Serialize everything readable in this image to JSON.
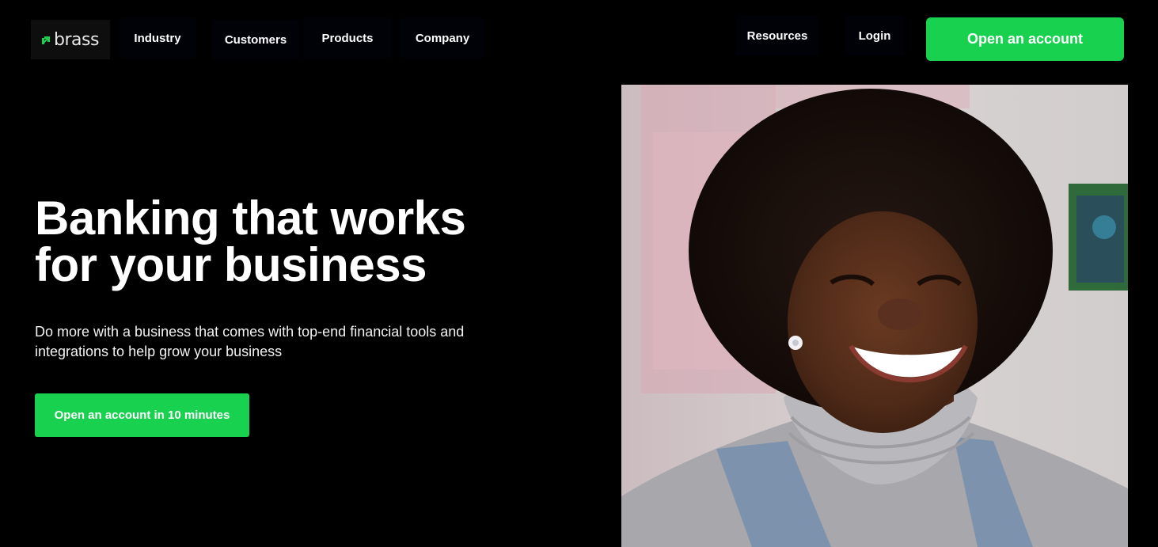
{
  "header": {
    "logo_text": "brass",
    "nav": {
      "industry": "Industry",
      "customers": "Customers",
      "products": "Products",
      "company": "Company",
      "resources": "Resources",
      "login": "Login"
    },
    "cta_label": "Open an account"
  },
  "hero": {
    "title_line1": "Banking that works",
    "title_line2": "for your business",
    "subtitle_line1": "Do more with a business that comes with top-end financial tools and",
    "subtitle_line2": "integrations to help grow your business",
    "cta_label": "Open an account in 10 minutes"
  },
  "icons": {
    "logo": "brass-arrow-logo-icon"
  },
  "colors": {
    "background": "#000000",
    "accent_green": "#17d14f",
    "text": "#ffffff"
  }
}
